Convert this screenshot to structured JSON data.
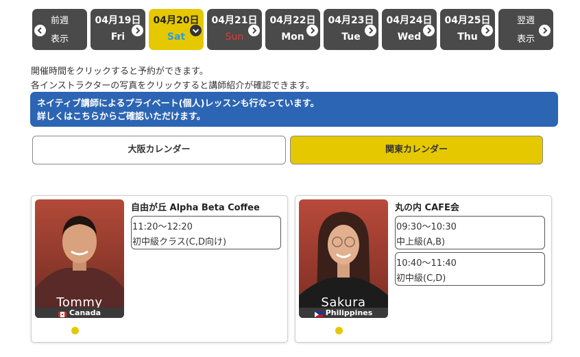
{
  "date_nav": {
    "prev": {
      "line1": "前週",
      "line2": "表示"
    },
    "days": [
      {
        "date": "04月19日",
        "dow": "Fri",
        "selected": false
      },
      {
        "date": "04月20日",
        "dow": "Sat",
        "selected": true
      },
      {
        "date": "04月21日",
        "dow": "Sun",
        "selected": false
      },
      {
        "date": "04月22日",
        "dow": "Mon",
        "selected": false
      },
      {
        "date": "04月23日",
        "dow": "Tue",
        "selected": false
      },
      {
        "date": "04月24日",
        "dow": "Wed",
        "selected": false
      },
      {
        "date": "04月25日",
        "dow": "Thu",
        "selected": false
      }
    ],
    "next": {
      "line1": "翌週",
      "line2": "表示"
    }
  },
  "instructions": {
    "line1": "開催時間をクリックすると予約ができます。",
    "line2": "各インストラクターの写真をクリックすると講師紹介が確認できます。"
  },
  "banner": {
    "line1": "ネイティブ講師によるプライベート(個人)レッスンも行なっています。",
    "line2": "詳しくはこちらからご確認いただけます。"
  },
  "calendars": {
    "osaka": "大阪カレンダー",
    "kanto": "関東カレンダー"
  },
  "instructors": [
    {
      "name": "Tommy",
      "country": "Canada",
      "venue": "自由が丘 Alpha Beta Coffee",
      "slots": [
        {
          "time": "11:20〜12:20",
          "level": "初中級クラス(C,D向け)"
        }
      ]
    },
    {
      "name": "Sakura",
      "country": "Philippines",
      "venue": "丸の内 CAFE会",
      "slots": [
        {
          "time": "09:30〜10:30",
          "level": "中上級(A,B)"
        },
        {
          "time": "10:40〜11:40",
          "level": "初中級(C,D)"
        }
      ]
    }
  ],
  "colors": {
    "accent_yellow": "#e6c800",
    "nav_dark": "#4a4a4a",
    "banner_blue": "#2c65b3",
    "saturday_blue": "#2a9be0",
    "sunday_red": "#e03a3a"
  }
}
